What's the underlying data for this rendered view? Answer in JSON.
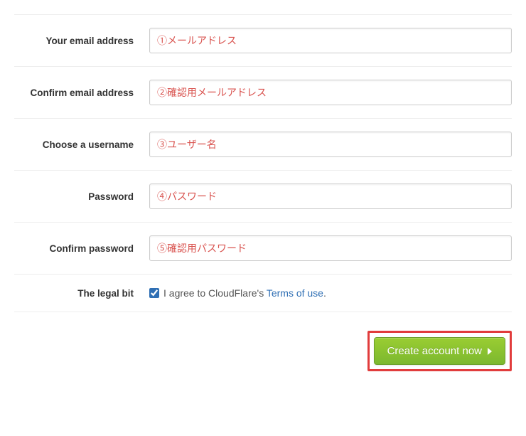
{
  "fields": {
    "email": {
      "label": "Your email address",
      "value": "①メールアドレス"
    },
    "confirm_email": {
      "label": "Confirm email address",
      "value": "②確認用メールアドレス"
    },
    "username": {
      "label": "Choose a username",
      "value": "③ユーザー名"
    },
    "password": {
      "label": "Password",
      "value": "④パスワード"
    },
    "confirm_password": {
      "label": "Confirm password",
      "value": "⑤確認用パスワード"
    }
  },
  "legal": {
    "label": "The legal bit",
    "agree_prefix": "I agree to CloudFlare's ",
    "terms_link_text": "Terms of use",
    "suffix": ".",
    "checked": true
  },
  "submit": {
    "label": "Create account now"
  },
  "colors": {
    "annotation_red": "#d9534f",
    "green": "#7CB82F",
    "link": "#2f6fb4",
    "highlight": "#e13c3c"
  }
}
